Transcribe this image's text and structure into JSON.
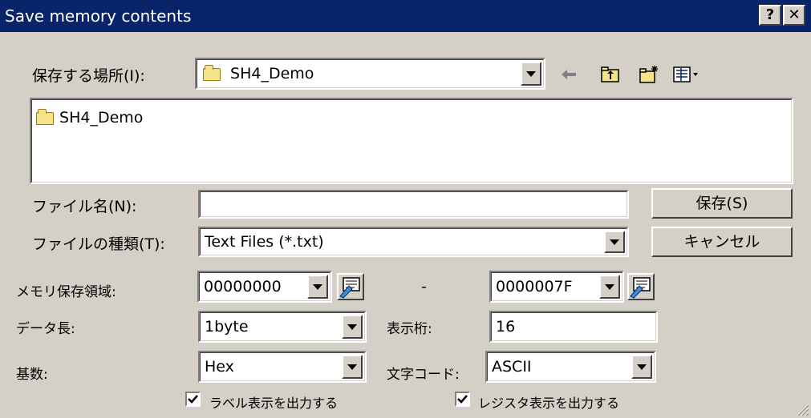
{
  "title": "Save memory contents",
  "title_buttons": {
    "help": "?",
    "close": "✕"
  },
  "save_in": {
    "label": "保存する場所(I):",
    "value": "SH4_Demo"
  },
  "file_list": [
    "SH4_Demo"
  ],
  "file_name": {
    "label": "ファイル名(N):",
    "value": ""
  },
  "file_type": {
    "label": "ファイルの種類(T):",
    "value": "Text Files (*.txt)"
  },
  "buttons": {
    "save": "保存(S)",
    "cancel": "キャンセル"
  },
  "memory_area": {
    "label": "メモリ保存領域:",
    "start": "00000000",
    "separator": "-",
    "end": "0000007F"
  },
  "data_length": {
    "label": "データ長:",
    "value": "1byte"
  },
  "display_digits": {
    "label": "表示桁:",
    "value": "16"
  },
  "radix": {
    "label": "基数:",
    "value": "Hex"
  },
  "char_code": {
    "label": "文字コード:",
    "value": "ASCII"
  },
  "checkboxes": [
    {
      "label": "ラベル表示を出力する",
      "checked": true
    },
    {
      "label": "レジスタ表示を出力する",
      "checked": true
    }
  ],
  "colors": {
    "titlebar": "#0a246a",
    "face": "#d4d0c8",
    "folder": "#f5e58a"
  },
  "icons": [
    "folder-icon",
    "back-arrow-icon",
    "up-folder-icon",
    "new-folder-icon",
    "view-menu-icon",
    "address-picker-icon",
    "checkmark-icon"
  ]
}
